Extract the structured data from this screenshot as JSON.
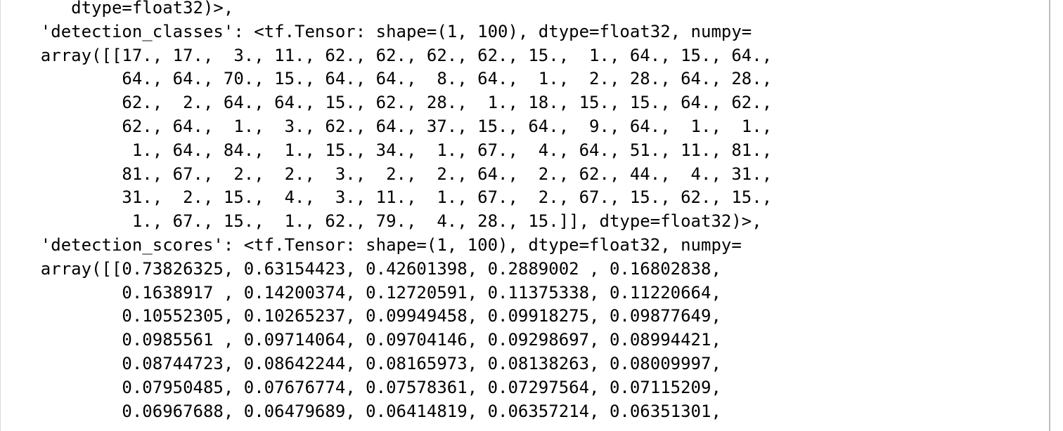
{
  "output": {
    "lines": [
      "       dtype=float32)>,",
      "    'detection_classes': <tf.Tensor: shape=(1, 100), dtype=float32, numpy=",
      "    array([[17., 17.,  3., 11., 62., 62., 62., 62., 15.,  1., 64., 15., 64.,",
      "            64., 64., 70., 15., 64., 64.,  8., 64.,  1.,  2., 28., 64., 28.,",
      "            62.,  2., 64., 64., 15., 62., 28.,  1., 18., 15., 15., 64., 62.,",
      "            62., 64.,  1.,  3., 62., 64., 37., 15., 64.,  9., 64.,  1.,  1.,",
      "             1., 64., 84.,  1., 15., 34.,  1., 67.,  4., 64., 51., 11., 81.,",
      "            81., 67.,  2.,  2.,  3.,  2.,  2., 64.,  2., 62., 44.,  4., 31.,",
      "            31.,  2., 15.,  4.,  3., 11.,  1., 67.,  2., 67., 15., 62., 15.,",
      "             1., 67., 15.,  1., 62., 79.,  4., 28., 15.]], dtype=float32)>,",
      "    'detection_scores': <tf.Tensor: shape=(1, 100), dtype=float32, numpy=",
      "    array([[0.73826325, 0.63154423, 0.42601398, 0.2889002 , 0.16802838,",
      "            0.1638917 , 0.14200374, 0.12720591, 0.11375338, 0.11220664,",
      "            0.10552305, 0.10265237, 0.09949458, 0.09918275, 0.09877649,",
      "            0.0985561 , 0.09714064, 0.09704146, 0.09298697, 0.08994421,",
      "            0.08744723, 0.08642244, 0.08165973, 0.08138263, 0.08009997,",
      "            0.07950485, 0.07676774, 0.07578361, 0.07297564, 0.07115209,",
      "            0.06967688, 0.06479689, 0.06414819, 0.06357214, 0.06351301,"
    ]
  }
}
